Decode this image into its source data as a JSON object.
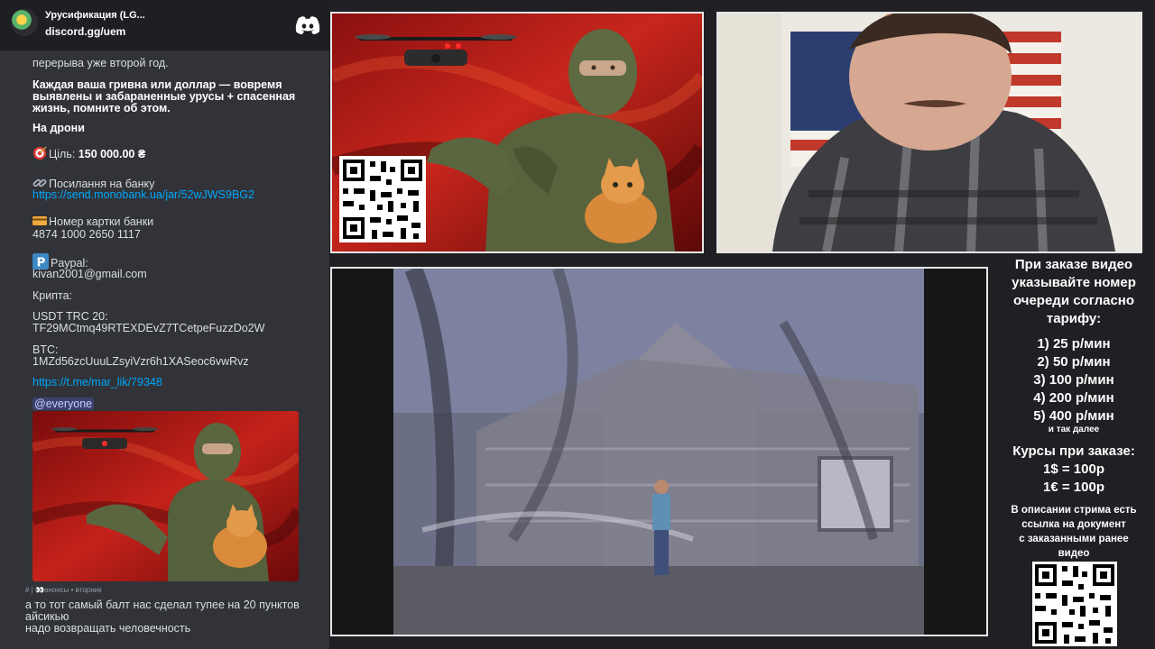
{
  "discord": {
    "server_name": "Урусификация (LG...",
    "invite": "discord.gg/uem",
    "message": {
      "line_cut": "перерыва уже второй год.",
      "bold_text": "Каждая ваша гривна или доллар — вовремя выявлены и забараненные урусы + спасенная жизнь, помните об этом.",
      "drones_header": "На дрони",
      "goal_label": "Ціль:",
      "goal_value": "150 000.00 ₴",
      "bank_link_label": "Посилання на банку",
      "bank_link": "https://send.monobank.ua/jar/52wJWS9BG2",
      "card_label": "Номер картки банки",
      "card_number": "4874 1000 2650 1117",
      "paypal_label": "Paypal:",
      "paypal_email": "kivan2001@gmail.com",
      "crypto_label": "Крипта:",
      "usdt_label": "USDT TRC 20:",
      "usdt_address": "TF29MCtmq49RTEXDEvZ7TCetpeFuzzDo2W",
      "btc_label": "BTC:",
      "btc_address": "1MZd56zcUuuLZsyiVzr6h1XASeoc6vwRvz",
      "telegram_link": "https://t.me/mar_lik/79348",
      "mention": "@everyone"
    },
    "channel_tag": "# | 👀анонсы • вторник",
    "chat_lines": [
      "а то тот самый балт нас сделал тупее на 20 пунктов",
      "айсикью",
      "надо возвращать человечность"
    ],
    "icons": {
      "goal": "target-icon",
      "link": "link-icon",
      "card": "credit-card-icon",
      "paypal": "parking-p-icon"
    }
  },
  "info_panel": {
    "order_text": [
      "При заказе видео",
      "указывайте номер",
      "очереди согласно",
      "тарифу:"
    ],
    "tariffs": [
      "1) 25 р/мин",
      "2) 50 р/мин",
      "3) 100 р/мин",
      "4) 200 р/мин",
      "5) 400 р/мин"
    ],
    "and_so_on": "и так далее",
    "rates_header": "Курсы при заказе:",
    "rates": [
      "1$ = 100р",
      "1€ = 100р"
    ],
    "description_note": [
      "В описании стрима есть",
      "ссылка на документ",
      "с заказанными ранее",
      "видео"
    ]
  },
  "colors": {
    "discord_bg": "#313338",
    "discord_header": "#1e1f22",
    "link": "#00a8fc",
    "poster_red": "#b01818",
    "page_bg": "#1f1f24"
  }
}
